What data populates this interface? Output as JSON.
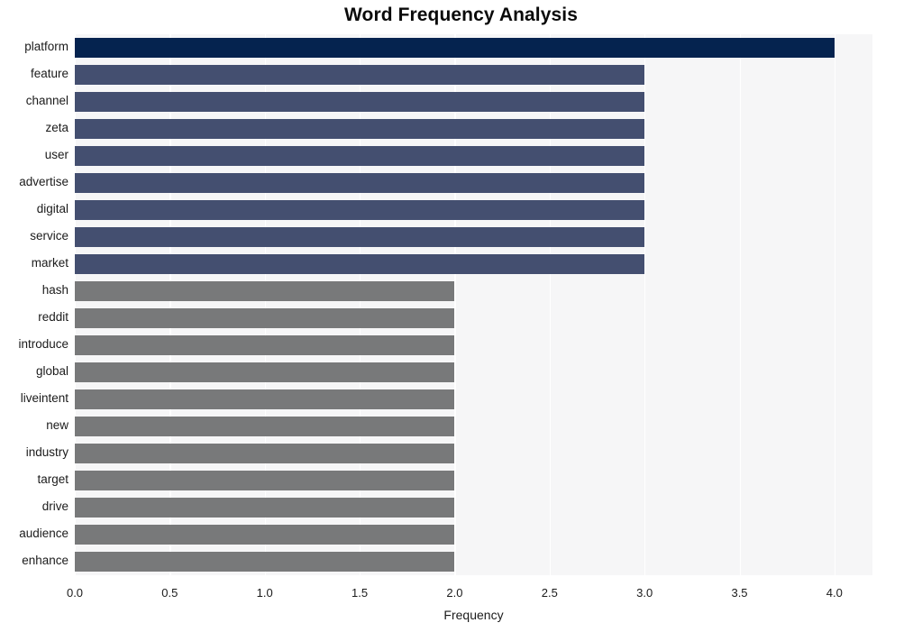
{
  "chart_data": {
    "type": "bar",
    "orientation": "horizontal",
    "title": "Word Frequency Analysis",
    "xlabel": "Frequency",
    "ylabel": "",
    "categories": [
      "platform",
      "feature",
      "channel",
      "zeta",
      "user",
      "advertise",
      "digital",
      "service",
      "market",
      "hash",
      "reddit",
      "introduce",
      "global",
      "liveintent",
      "new",
      "industry",
      "target",
      "drive",
      "audience",
      "enhance"
    ],
    "values": [
      4,
      3,
      3,
      3,
      3,
      3,
      3,
      3,
      3,
      2,
      2,
      2,
      2,
      2,
      2,
      2,
      2,
      2,
      2,
      2
    ],
    "bar_colors": [
      "#05234f",
      "#444f70",
      "#444f70",
      "#444f70",
      "#444f70",
      "#444f70",
      "#444f70",
      "#444f70",
      "#444f70",
      "#78797a",
      "#78797a",
      "#78797a",
      "#78797a",
      "#78797a",
      "#78797a",
      "#78797a",
      "#78797a",
      "#78797a",
      "#78797a",
      "#78797a"
    ],
    "xlim": [
      0.0,
      4.2
    ],
    "xticks": [
      0.0,
      0.5,
      1.0,
      1.5,
      2.0,
      2.5,
      3.0,
      3.5,
      4.0
    ],
    "xtick_labels": [
      "0.0",
      "0.5",
      "1.0",
      "1.5",
      "2.0",
      "2.5",
      "3.0",
      "3.5",
      "4.0"
    ],
    "grid": true,
    "grid_axis": "x",
    "grid_color": "#ffffff",
    "plot_background": "#f6f6f7",
    "figure_background": "#ffffff",
    "legend": null,
    "legend_position": "none",
    "text_color": "#1b1b1b",
    "title_color": "#0a0a0a"
  }
}
